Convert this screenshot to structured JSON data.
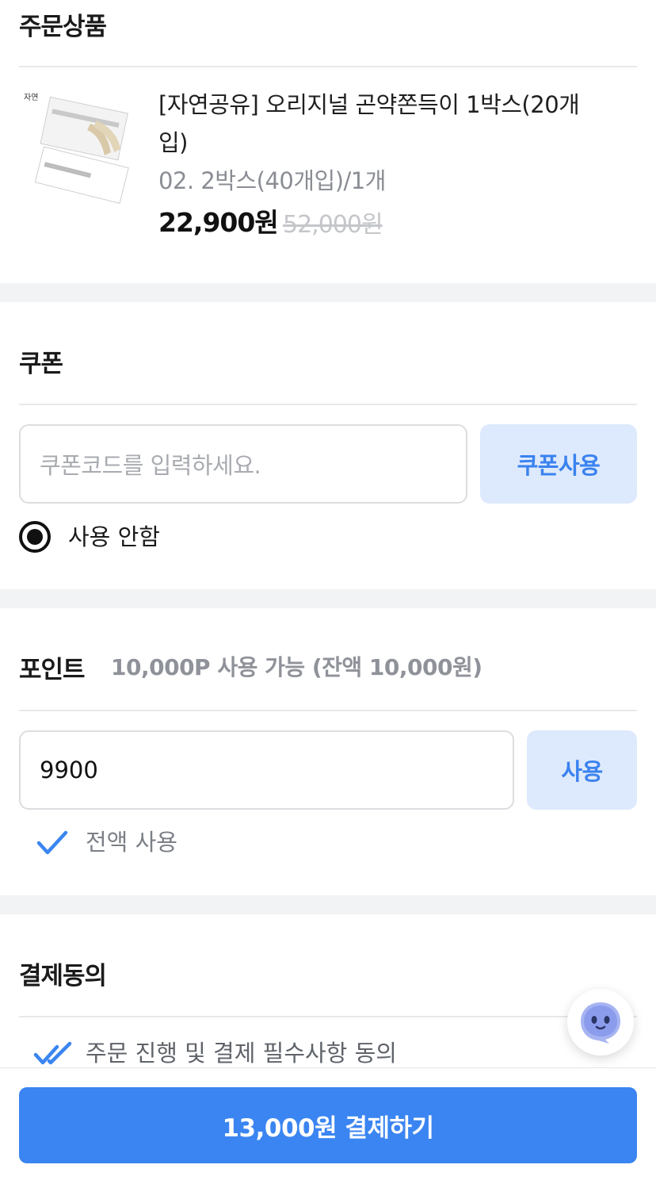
{
  "order": {
    "title": "주문상품",
    "product": {
      "name": "[자연공유] 오리지널 곤약쫀득이 1박스(20개입)",
      "option": "02. 2박스(40개입)/1개",
      "price": "22,900원",
      "original_price": "52,000원"
    }
  },
  "coupon": {
    "title": "쿠폰",
    "placeholder": "쿠폰코드를 입력하세요.",
    "apply_label": "쿠폰사용",
    "radio_label": "사용 안함"
  },
  "point": {
    "title": "포인트",
    "available": "10,000P 사용 가능 (잔액 10,000원)",
    "input_value": "9900",
    "apply_label": "사용",
    "use_all_label": "전액 사용"
  },
  "agreement": {
    "title": "결제동의",
    "item_label": "주문 진행 및 결제 필수사항 동의"
  },
  "pay_button_label": "13,000원 결제하기",
  "colors": {
    "accent": "#3a85f1",
    "accent_light": "#dde9fc",
    "section_gap": "#f2f3f5"
  },
  "icons": [
    "product-thumbnail",
    "radio-selected-icon",
    "check-icon",
    "double-check-icon",
    "chatbot-icon"
  ]
}
